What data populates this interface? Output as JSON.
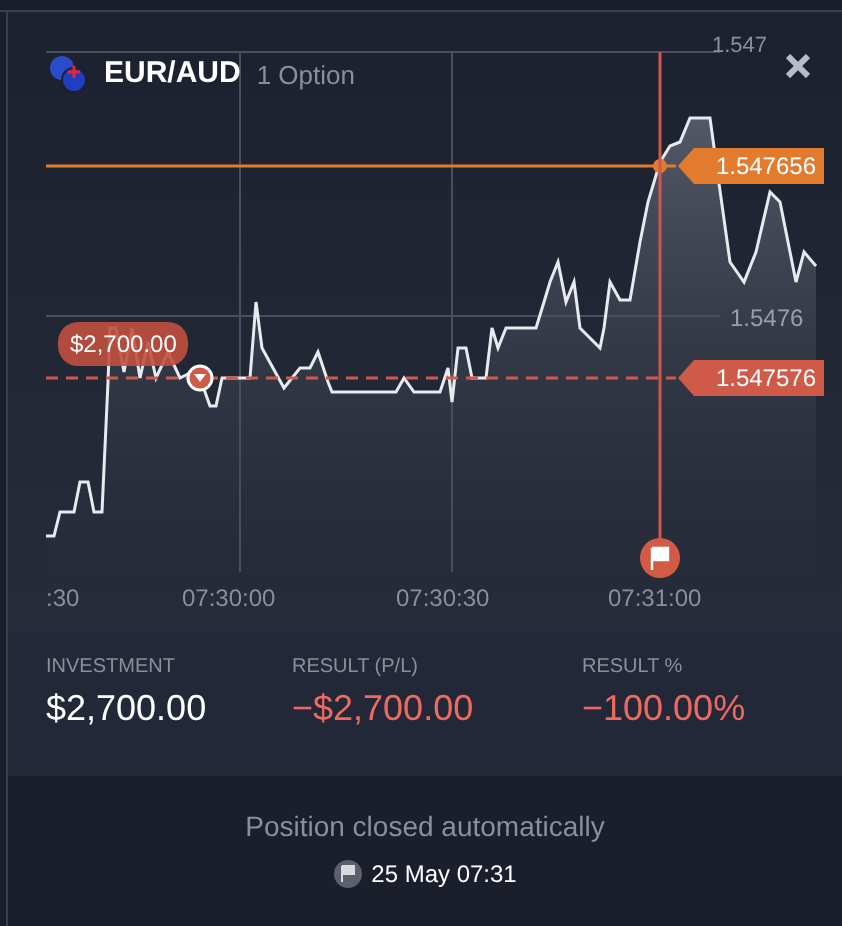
{
  "header": {
    "symbol": "EUR/AUD",
    "option_count": "1 Option"
  },
  "chart": {
    "y_labels": [
      "1.547",
      "1.5476"
    ],
    "x_labels": [
      ":30",
      "07:30:00",
      "07:30:30",
      "07:31:00"
    ],
    "price_lines": [
      {
        "label": "1.547656",
        "color": "#e37b2f",
        "kind": "solid"
      },
      {
        "label": "1.547576",
        "color": "#cf5a48",
        "kind": "dashed"
      }
    ],
    "investment_tag": "$2,700.00"
  },
  "stats": [
    {
      "label": "INVESTMENT",
      "value": "$2,700.00",
      "negative": false
    },
    {
      "label": "RESULT (P/L)",
      "value": "−$2,700.00",
      "negative": true
    },
    {
      "label": "RESULT %",
      "value": "−100.00%",
      "negative": true
    }
  ],
  "footer": {
    "message": "Position closed automatically",
    "closed_at": "25 May 07:31"
  }
}
